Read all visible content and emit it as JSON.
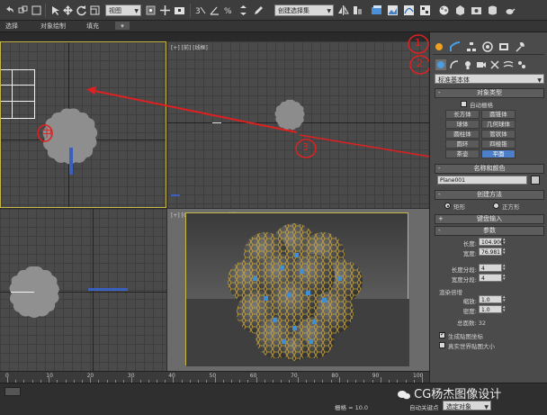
{
  "toolbar": {
    "filter_select": "视图",
    "selection_set": "创建选择集"
  },
  "ribbon": {
    "tabs": [
      "选择",
      "对象绘制",
      "填充"
    ]
  },
  "viewports": {
    "top_label": "",
    "front_label": "[+] [前] [线框]",
    "left_label": "",
    "camera_label": "[+] [Camera001] [明暗处理]"
  },
  "annotations": {
    "top_mark": "中",
    "mark_1": "1",
    "mark_2": "2",
    "mark_3": "3",
    "mark_color": "#e02020"
  },
  "panel": {
    "category_select": "标准基本体",
    "object_type": {
      "title": "对象类型",
      "autogrid": "自动栅格",
      "buttons": [
        "长方体",
        "圆锥体",
        "球体",
        "几何球体",
        "圆柱体",
        "管状体",
        "圆环",
        "四棱锥",
        "茶壶",
        "平面"
      ],
      "active_index": 9
    },
    "name_color": {
      "title": "名称和颜色",
      "name": "Plane001"
    },
    "creation_method": {
      "title": "创建方法",
      "options": [
        "矩形",
        "正方形"
      ],
      "selected_index": 0
    },
    "keyboard_entry": "键盘输入",
    "parameters": {
      "title": "参数",
      "length_label": "长度:",
      "length_value": "104.906",
      "width_label": "宽度:",
      "width_value": "76.981",
      "length_segs_label": "长度分段:",
      "length_segs_value": "4",
      "width_segs_label": "宽度分段:",
      "width_segs_value": "4",
      "render_mult_title": "渲染倍增",
      "scale_label": "缩放:",
      "scale_value": "1.0",
      "density_label": "密度:",
      "density_value": "1.0",
      "total_faces": "总面数: 32",
      "gen_map_coords": "生成贴图坐标",
      "real_world_map": "真实世界贴图大小"
    }
  },
  "timeline": {
    "ticks": [
      "0",
      "10",
      "20",
      "30",
      "40",
      "50",
      "60",
      "70",
      "80",
      "90",
      "100"
    ]
  },
  "status": {
    "grid_label": "栅格 = 10.0",
    "auto_key": "自动关键点",
    "select_object": "选定对象",
    "watermark": "CG杨杰图像设计"
  },
  "colors": {
    "accent_blue": "#4d7fc8",
    "viewport_border": "#c8b84a",
    "sphere_gold": "#c9a436"
  }
}
